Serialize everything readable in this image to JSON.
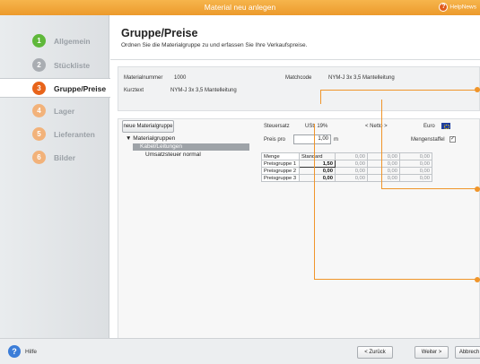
{
  "window": {
    "title": "Material neu anlegen",
    "helpnews": "HelpNews",
    "helpnews_icon": "help-icon"
  },
  "steps": [
    {
      "num": "1",
      "label": "Allgemein",
      "color": "#5fb83a",
      "state": "done"
    },
    {
      "num": "2",
      "label": "Stückliste",
      "color": "#a9adb2",
      "state": "disabled"
    },
    {
      "num": "3",
      "label": "Gruppe/Preise",
      "color": "#e8641a",
      "state": "active"
    },
    {
      "num": "4",
      "label": "Lager",
      "color": "#f2b27a",
      "state": "pending"
    },
    {
      "num": "5",
      "label": "Lieferanten",
      "color": "#f2b27a",
      "state": "pending"
    },
    {
      "num": "6",
      "label": "Bilder",
      "color": "#f2b27a",
      "state": "pending"
    }
  ],
  "header": {
    "title": "Gruppe/Preise",
    "subtitle": "Ordnen Sie die Materialgruppe zu und erfassen Sie Ihre Verkaufspreise."
  },
  "info": {
    "materialnummer_label": "Materialnummer",
    "materialnummer": "1000",
    "matchcode_label": "Matchcode",
    "matchcode": "NYM-J 3x 3,5 Mantelleitung",
    "kurztext_label": "Kurztext",
    "kurztext": "NYM-J 3x 3,5 Mantelleitung"
  },
  "groups": {
    "new_button": "neue Materialgruppe",
    "root": "Materialgruppen",
    "children": [
      "Kabel/Leitungen",
      "Umsatzsteuer normal"
    ],
    "selected_index": 0
  },
  "pricing": {
    "steuersatz_label": "Steuersatz",
    "steuersatz": "USt. 19%",
    "netto": "< Netto >",
    "currency": "Euro",
    "preis_pro_label": "Preis pro",
    "preis_pro_value": "1,00",
    "preis_pro_unit": "m",
    "mengenstaffel_label": "Mengenstaffel",
    "mengenstaffel_checked": true,
    "table": {
      "header": [
        "Menge",
        "Standard",
        "0,00",
        "0,00",
        "0,00"
      ],
      "rows": [
        {
          "label": "Preisgruppe 1",
          "values": [
            "1,50",
            "0,00",
            "0,00",
            "0,00"
          ]
        },
        {
          "label": "Preisgruppe 2",
          "values": [
            "0,00",
            "0,00",
            "0,00",
            "0,00"
          ]
        },
        {
          "label": "Preisgruppe 3",
          "values": [
            "0,00",
            "0,00",
            "0,00",
            "0,00"
          ]
        }
      ]
    }
  },
  "footer": {
    "help": "Hilfe",
    "back": "< Zurück",
    "next": "Weiter >",
    "cancel": "Abbrech"
  },
  "colors": {
    "accent": "#f0952a",
    "titlebar": "#ec9a2c"
  }
}
